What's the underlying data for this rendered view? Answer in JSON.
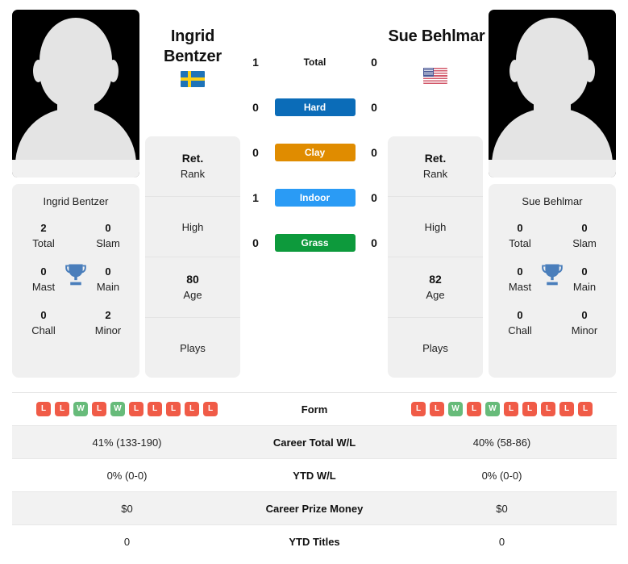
{
  "players": {
    "left": {
      "name": "Ingrid Bentzer",
      "name_line1": "Ingrid",
      "name_line2": "Bentzer",
      "country": "Sweden",
      "flag_icon": "flag-sweden-icon",
      "photo_alt": "player-photo-placeholder",
      "info": [
        {
          "value": "Ret.",
          "key": "Rank"
        },
        {
          "value": "",
          "key": "High"
        },
        {
          "value": "80",
          "key": "Age"
        },
        {
          "value": "",
          "key": "Plays"
        }
      ],
      "titles": {
        "caption": "Ingrid Bentzer",
        "cells": [
          {
            "num": "2",
            "key": "Total"
          },
          {
            "num": "0",
            "key": "Slam"
          },
          {
            "num": "0",
            "key": "Mast"
          },
          {
            "num": "0",
            "key": "Main"
          },
          {
            "num": "0",
            "key": "Chall"
          },
          {
            "num": "2",
            "key": "Minor"
          }
        ]
      },
      "form": [
        "L",
        "L",
        "W",
        "L",
        "W",
        "L",
        "L",
        "L",
        "L",
        "L"
      ],
      "career_total_wl": "41% (133-190)",
      "ytd_wl": "0% (0-0)",
      "career_prize_money": "$0",
      "ytd_titles": "0"
    },
    "right": {
      "name": "Sue Behlmar",
      "name_line1": "Sue Behlmar",
      "name_line2": "",
      "country": "United States",
      "flag_icon": "flag-usa-icon",
      "photo_alt": "player-photo-placeholder",
      "info": [
        {
          "value": "Ret.",
          "key": "Rank"
        },
        {
          "value": "",
          "key": "High"
        },
        {
          "value": "82",
          "key": "Age"
        },
        {
          "value": "",
          "key": "Plays"
        }
      ],
      "titles": {
        "caption": "Sue Behlmar",
        "cells": [
          {
            "num": "0",
            "key": "Total"
          },
          {
            "num": "0",
            "key": "Slam"
          },
          {
            "num": "0",
            "key": "Mast"
          },
          {
            "num": "0",
            "key": "Main"
          },
          {
            "num": "0",
            "key": "Chall"
          },
          {
            "num": "0",
            "key": "Minor"
          }
        ]
      },
      "form": [
        "L",
        "L",
        "W",
        "L",
        "W",
        "L",
        "L",
        "L",
        "L",
        "L"
      ],
      "career_total_wl": "40% (58-86)",
      "ytd_wl": "0% (0-0)",
      "career_prize_money": "$0",
      "ytd_titles": "0"
    }
  },
  "h2h": [
    {
      "label": "Total",
      "left": "1",
      "right": "0",
      "style": "plain",
      "color": ""
    },
    {
      "label": "Hard",
      "left": "0",
      "right": "0",
      "style": "badge",
      "color": "#0b6cb8"
    },
    {
      "label": "Clay",
      "left": "0",
      "right": "0",
      "style": "badge",
      "color": "#e08c00"
    },
    {
      "label": "Indoor",
      "left": "1",
      "right": "0",
      "style": "badge",
      "color": "#2a9bf5"
    },
    {
      "label": "Grass",
      "left": "0",
      "right": "0",
      "style": "badge",
      "color": "#0d9a3c"
    }
  ],
  "table_rows": [
    {
      "label": "Form",
      "type": "form"
    },
    {
      "label": "Career Total W/L",
      "type": "text",
      "field": "career_total_wl"
    },
    {
      "label": "YTD W/L",
      "type": "text",
      "field": "ytd_wl"
    },
    {
      "label": "Career Prize Money",
      "type": "text",
      "field": "career_prize_money"
    },
    {
      "label": "YTD Titles",
      "type": "text",
      "field": "ytd_titles"
    }
  ],
  "colors": {
    "win": "#67bb7a",
    "loss": "#f05b47",
    "trophy": "#4a7ebb",
    "card_bg": "#f0f0f0",
    "row_alt_bg": "#f2f2f2"
  }
}
